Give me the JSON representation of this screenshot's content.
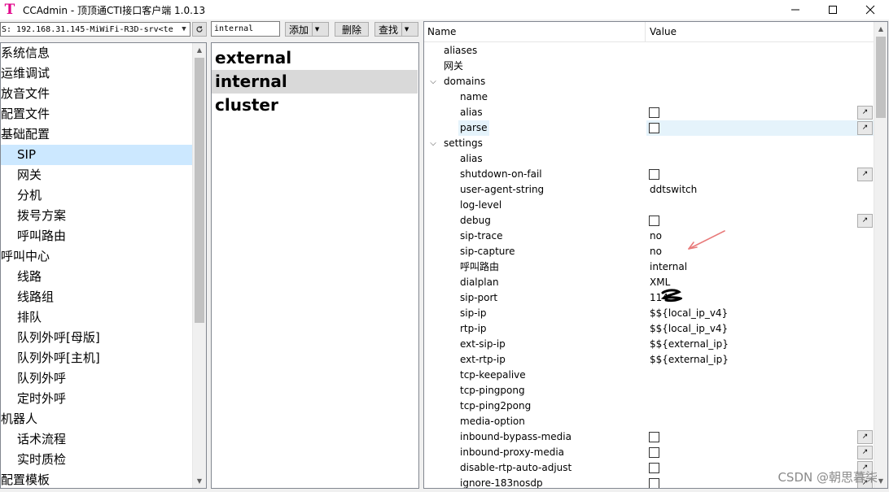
{
  "window": {
    "title": "CCAdmin - 顶顶通CTI接口客户端 1.0.13",
    "icon_letter": "T",
    "controls": [
      "minimize-icon",
      "maximize-icon",
      "close-icon"
    ]
  },
  "toolbar": {
    "host_value": "S: 192.168.31.145-MiWiFi-R3D-srv<te",
    "search_value": "internal",
    "add_label": "添加",
    "delete_label": "删除",
    "find_label": "查找"
  },
  "nav": {
    "items": [
      {
        "label": "系统信息",
        "level": 0
      },
      {
        "label": "运维调试",
        "level": 0
      },
      {
        "label": "放音文件",
        "level": 0
      },
      {
        "label": "配置文件",
        "level": 0
      },
      {
        "label": "基础配置",
        "level": 0
      },
      {
        "label": "SIP",
        "level": 1,
        "selected": true
      },
      {
        "label": "网关",
        "level": 1
      },
      {
        "label": "分机",
        "level": 1
      },
      {
        "label": "拨号方案",
        "level": 1
      },
      {
        "label": "呼叫路由",
        "level": 1
      },
      {
        "label": "呼叫中心",
        "level": 0
      },
      {
        "label": "线路",
        "level": 1
      },
      {
        "label": "线路组",
        "level": 1
      },
      {
        "label": "排队",
        "level": 1
      },
      {
        "label": "队列外呼[母版]",
        "level": 1
      },
      {
        "label": "队列外呼[主机]",
        "level": 1
      },
      {
        "label": "队列外呼",
        "level": 1
      },
      {
        "label": "定时外呼",
        "level": 1
      },
      {
        "label": "机器人",
        "level": 0
      },
      {
        "label": "话术流程",
        "level": 1
      },
      {
        "label": "实时质检",
        "level": 1
      },
      {
        "label": "配置模板",
        "level": 0
      }
    ]
  },
  "profiles": {
    "items": [
      {
        "label": "external"
      },
      {
        "label": "internal",
        "selected": true
      },
      {
        "label": "cluster"
      }
    ]
  },
  "grid": {
    "name_header": "Name",
    "value_header": "Value",
    "rows": [
      {
        "name": "aliases",
        "depth": 1,
        "value": ""
      },
      {
        "name": "网关",
        "depth": 1,
        "value": ""
      },
      {
        "name": "domains",
        "depth": 1,
        "expander": "expanded",
        "value": ""
      },
      {
        "name": "name",
        "depth": 2,
        "value": ""
      },
      {
        "name": "alias",
        "depth": 2,
        "checkbox": true,
        "edit": true
      },
      {
        "name": "parse",
        "depth": 2,
        "checkbox": true,
        "edit": true,
        "highlight": true
      },
      {
        "name": "settings",
        "depth": 1,
        "expander": "expanded",
        "value": ""
      },
      {
        "name": "alias",
        "depth": 2,
        "value": ""
      },
      {
        "name": "shutdown-on-fail",
        "depth": 2,
        "checkbox": true,
        "edit": true
      },
      {
        "name": "user-agent-string",
        "depth": 2,
        "value": "ddtswitch"
      },
      {
        "name": "log-level",
        "depth": 2,
        "value": ""
      },
      {
        "name": "debug",
        "depth": 2,
        "checkbox": true,
        "edit": true
      },
      {
        "name": "sip-trace",
        "depth": 2,
        "value": "no"
      },
      {
        "name": "sip-capture",
        "depth": 2,
        "value": "no"
      },
      {
        "name": "呼叫路由",
        "depth": 2,
        "value": "internal"
      },
      {
        "name": "dialplan",
        "depth": 2,
        "value": "XML"
      },
      {
        "name": "sip-port",
        "depth": 2,
        "value": "114"
      },
      {
        "name": "sip-ip",
        "depth": 2,
        "value": "$${local_ip_v4}"
      },
      {
        "name": "rtp-ip",
        "depth": 2,
        "value": "$${local_ip_v4}"
      },
      {
        "name": "ext-sip-ip",
        "depth": 2,
        "value": "$${external_ip}"
      },
      {
        "name": "ext-rtp-ip",
        "depth": 2,
        "value": "$${external_ip}"
      },
      {
        "name": "tcp-keepalive",
        "depth": 2,
        "value": ""
      },
      {
        "name": "tcp-pingpong",
        "depth": 2,
        "value": ""
      },
      {
        "name": "tcp-ping2pong",
        "depth": 2,
        "value": ""
      },
      {
        "name": "media-option",
        "depth": 2,
        "value": ""
      },
      {
        "name": "inbound-bypass-media",
        "depth": 2,
        "checkbox": true,
        "edit": true
      },
      {
        "name": "inbound-proxy-media",
        "depth": 2,
        "checkbox": true,
        "edit": true
      },
      {
        "name": "disable-rtp-auto-adjust",
        "depth": 2,
        "checkbox": true,
        "edit": true
      },
      {
        "name": "ignore-183nosdp",
        "depth": 2,
        "checkbox": true,
        "edit": true
      }
    ]
  },
  "watermark": "CSDN @朝思暮柒",
  "colors": {
    "selection": "#cce8ff",
    "profile_selection": "#d9d9d9",
    "row_highlight": "#e5f3fb",
    "brand": "#e2008a",
    "annotation": "#e87a7a"
  }
}
